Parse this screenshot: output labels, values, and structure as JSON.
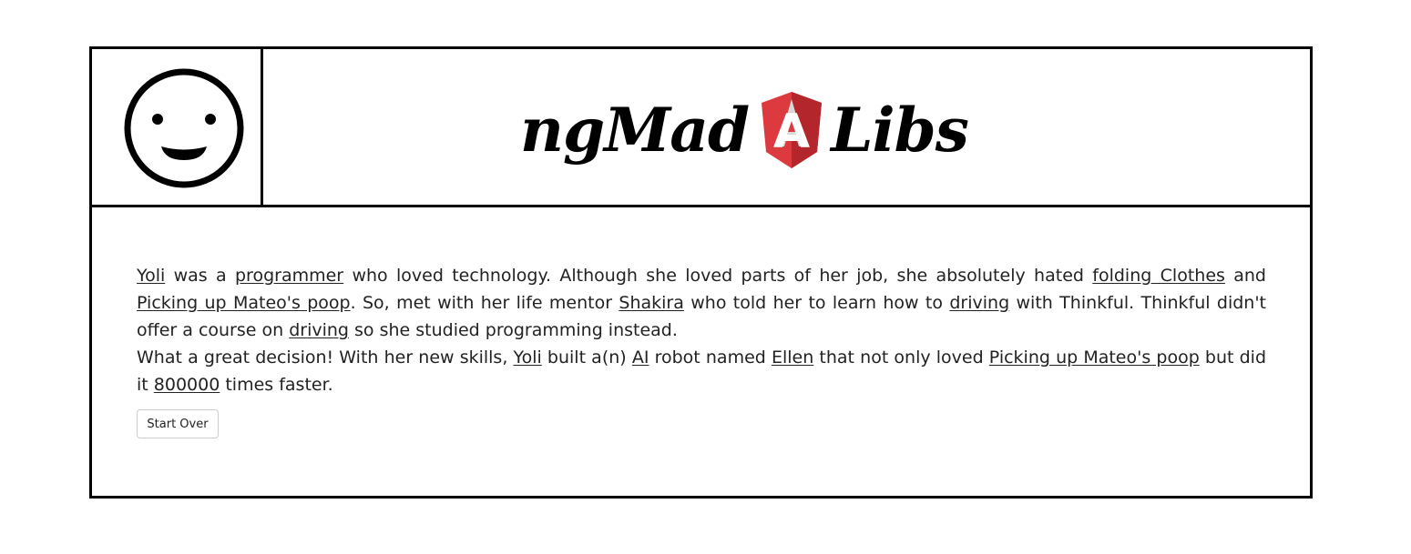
{
  "header": {
    "face_icon": "smiley-face-icon",
    "title_left": "ngMad",
    "logo_letter": "A",
    "logo_icon": "angular-logo-icon",
    "title_right": "Libs",
    "colors": {
      "logo_red": "#dd3a3f",
      "logo_dark_red": "#b3262c",
      "logo_letter": "#ffffff",
      "border": "#000000"
    }
  },
  "story": {
    "p1": {
      "name": "Yoli",
      "t1": " was a ",
      "job": "programmer",
      "t2": " who loved technology. Although she loved parts of her job, she absolutely hated ",
      "tedious_task": "folding Clothes",
      "t3": " and ",
      "dirty_task": "Picking up Mateo's poop",
      "t4": ". So, met with her life mentor ",
      "celebrity": "Shakira",
      "t5": " who told her to learn how to ",
      "useless_skill": "driving",
      "t6": " with Thinkful. Thinkful didn't offer a course on ",
      "useless_skill_2": "driving",
      "t7": " so she studied programming instead."
    },
    "p2": {
      "t1": "What a great decision! With her new skills, ",
      "name": "Yoli",
      "t2": " built a(n) ",
      "adjective": "AI",
      "t3": " robot named ",
      "celebrity": "Ellen",
      "t4": " that not only loved ",
      "dirty_task": "Picking up Mateo's poop",
      "t5": " but did it ",
      "huge_number": "800000",
      "t6": " times faster."
    }
  },
  "start_over_label": "Start Over"
}
